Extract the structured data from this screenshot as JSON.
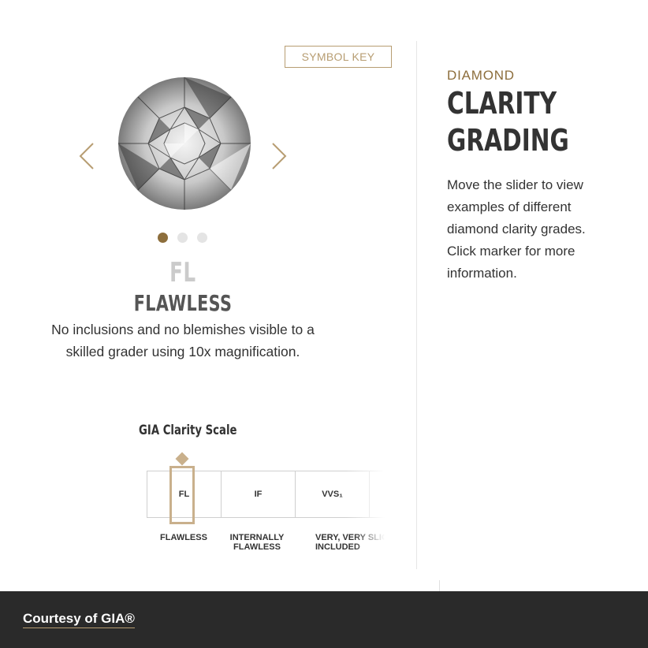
{
  "symbol_key_label": "SYMBOL KEY",
  "carousel": {
    "prev_icon": "chevron-left-icon",
    "next_icon": "chevron-right-icon",
    "dots": [
      {
        "active": true
      },
      {
        "active": false
      },
      {
        "active": false
      }
    ]
  },
  "grade": {
    "code": "FL",
    "name": "FLAWLESS",
    "description": "No inclusions and no blemishes visible to a skilled grader using 10x magnification."
  },
  "scale": {
    "title": "GIA Clarity Scale",
    "boxes": [
      "FL",
      "IF",
      "VVS₁",
      ""
    ],
    "labels": [
      {
        "text": "FLAWLESS"
      },
      {
        "text": "INTERNALLY\nFLAWLESS"
      },
      {
        "text": "VERY, VERY SLIGHTLY\nINCLUDED"
      }
    ],
    "selected_index": 0
  },
  "info": {
    "eyebrow": "DIAMOND",
    "headline_line1": "CLARITY",
    "headline_line2": "GRADING",
    "intro": "Move the slider to view examples of different diamond clarity grades. Click marker for more information."
  },
  "footer": {
    "credit": "Courtesy of GIA®"
  },
  "colors": {
    "accent_gold": "#8d6e3c",
    "border_gold": "#b79d72",
    "marker_gold": "#c9b08c",
    "footer_bg": "#2a2a2a"
  }
}
